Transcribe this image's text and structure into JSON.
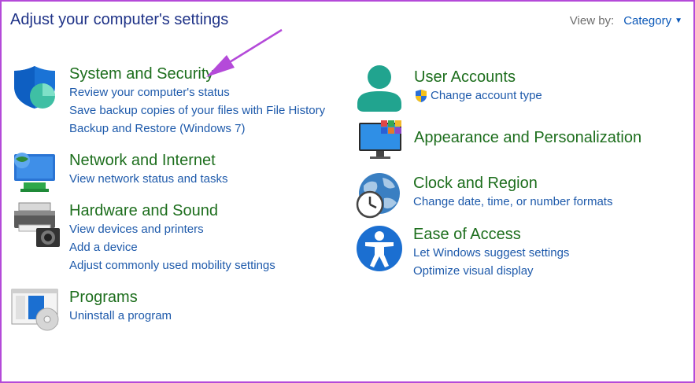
{
  "header": {
    "title": "Adjust your computer's settings",
    "view_by_label": "View by:",
    "view_by_value": "Category"
  },
  "left": {
    "system": {
      "title": "System and Security",
      "links": [
        "Review your computer's status",
        "Save backup copies of your files with File History",
        "Backup and Restore (Windows 7)"
      ]
    },
    "network": {
      "title": "Network and Internet",
      "links": [
        "View network status and tasks"
      ]
    },
    "hardware": {
      "title": "Hardware and Sound",
      "links": [
        "View devices and printers",
        "Add a device",
        "Adjust commonly used mobility settings"
      ]
    },
    "programs": {
      "title": "Programs",
      "links": [
        "Uninstall a program"
      ]
    }
  },
  "right": {
    "accounts": {
      "title": "User Accounts",
      "links": [
        "Change account type"
      ]
    },
    "appearance": {
      "title": "Appearance and Personalization"
    },
    "clock": {
      "title": "Clock and Region",
      "links": [
        "Change date, time, or number formats"
      ]
    },
    "ease": {
      "title": "Ease of Access",
      "links": [
        "Let Windows suggest settings",
        "Optimize visual display"
      ]
    }
  },
  "colors": {
    "category_title": "#1d6e1d",
    "link": "#1e5aab",
    "page_title": "#1e3287",
    "annotation_arrow": "#b44ad9"
  },
  "icons": {
    "system": "shield-icon",
    "network": "network-monitor-icon",
    "hardware": "printer-icon",
    "programs": "programs-icon",
    "accounts": "user-icon",
    "appearance": "monitor-palette-icon",
    "clock": "clock-globe-icon",
    "ease": "accessibility-icon"
  }
}
